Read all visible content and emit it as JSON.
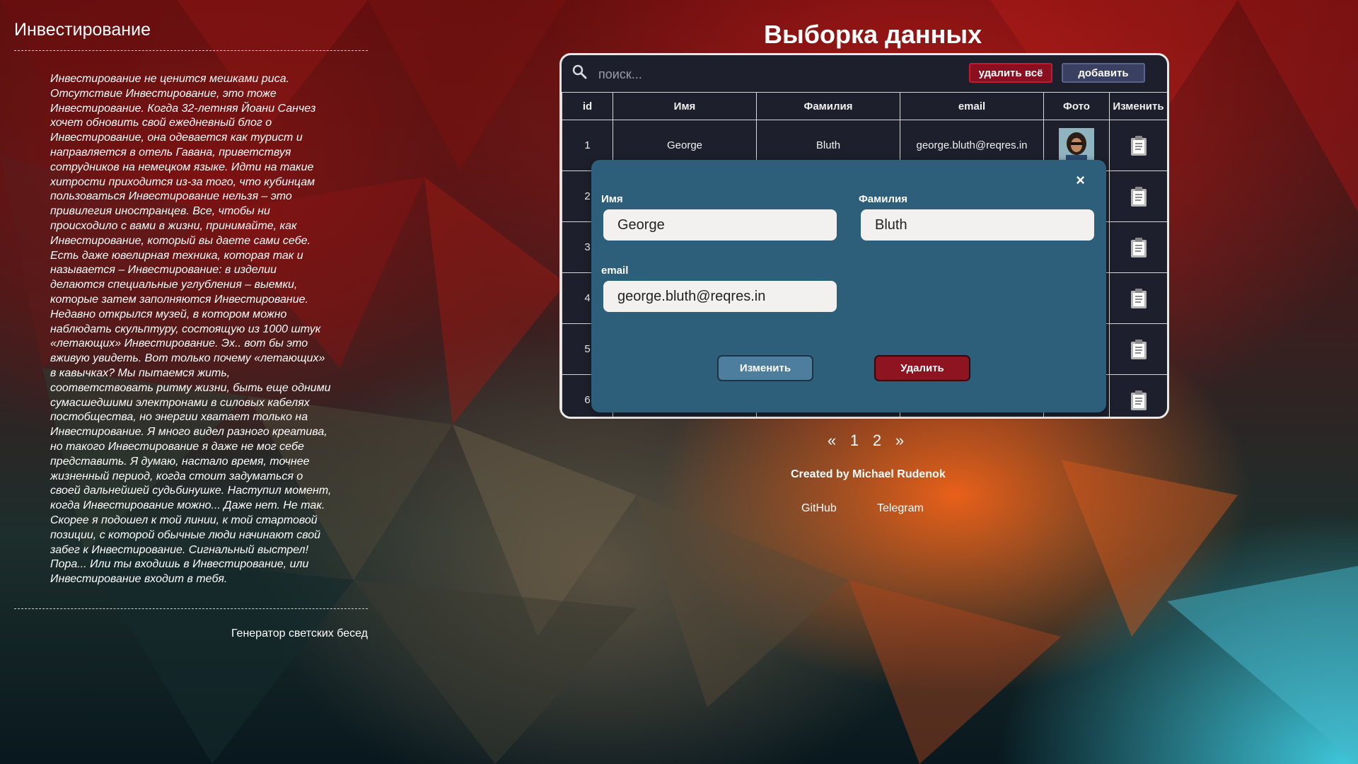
{
  "left": {
    "title": "Инвестирование",
    "paragraph": "Инвестирование не ценится мешками риса. Отсутствие Инвестирование, это тоже Инвестирование. Когда 32-летняя Йоани Санчез хочет обновить свой ежедневный блог о Инвестирование, она одевается как турист и направляется в отель Гавана, приветствуя сотрудников на немецком языке. Идти на такие хитрости приходится из-за того, что кубинцам пользоваться Инвестирование нельзя – это привилегия иностранцев. Все, чтобы ни происходило с вами в жизни, принимайте, как Инвестирование, который вы даете сами себе. Есть даже ювелирная техника, которая так и называется – Инвестирование: в изделии делаются специальные углубления – выемки, которые затем заполняются Инвестирование. Недавно открылся музей, в котором можно наблюдать скульптуру, состоящую из 1000 штук «летающих» Инвестирование. Эх.. вот бы это вживую увидеть. Вот только почему «летающих» в кавычках? Мы пытаемся жить, соответствовать ритму жизни, быть еще одними сумасшедшими электронами в силовых кабелях постобщества, но энергии хватает только на Инвестирование. Я много видел разного креатива, но такого Инвестирование я даже не мог себе представить. Я думаю, настало время, точнее жизненный период, когда стоит задуматься о своей дальнейшей судьбинушке. Наступил момент, когда Инвестирование можно... Даже нет. Не так. Скорее я подошел к той линии, к той стартовой позиции, с которой обычные люди начинают свой забег к Инвестирование. Сигнальный выстрел! Пора... Или ты входишь в Инвестирование, или Инвестирование входит в тебя.",
    "link": "Генератор светских бесед"
  },
  "main": {
    "title": "Выборка данных",
    "search_placeholder": "поиск...",
    "delete_all_label": "удалить всё",
    "add_label": "добавить",
    "columns": [
      "id",
      "Имя",
      "Фамилия",
      "email",
      "Фото",
      "Изменить"
    ],
    "rows": [
      {
        "id": "1",
        "first": "George",
        "last": "Bluth",
        "email": "george.bluth@reqres.in"
      },
      {
        "id": "2",
        "first": "",
        "last": "",
        "email": ""
      },
      {
        "id": "3",
        "first": "",
        "last": "",
        "email": ""
      },
      {
        "id": "4",
        "first": "",
        "last": "",
        "email": ""
      },
      {
        "id": "5",
        "first": "",
        "last": "",
        "email": ""
      },
      {
        "id": "6",
        "first": "",
        "last": "",
        "email": ""
      }
    ]
  },
  "modal": {
    "close": "×",
    "first_label": "Имя",
    "first_value": "George",
    "last_label": "Фамилия",
    "last_value": "Bluth",
    "email_label": "email",
    "email_value": "george.bluth@reqres.in",
    "edit_label": "Изменить",
    "delete_label": "Удалить"
  },
  "pagination": {
    "prev": "«",
    "pages": [
      "1",
      "2"
    ],
    "next": "»"
  },
  "footer": {
    "credit": "Created by Michael Rudenok",
    "github": "GitHub",
    "telegram": "Telegram"
  },
  "icons": {
    "search": "search-icon",
    "edit": "clipboard-icon",
    "close": "close-icon"
  },
  "colors": {
    "panel_bg": "#1d1f2c",
    "modal_bg": "#2d5e7a",
    "delete_btn": "#8a1020",
    "add_btn": "#3a4060",
    "edit_btn": "#4d7e9e",
    "remove_btn": "#8e1422"
  }
}
